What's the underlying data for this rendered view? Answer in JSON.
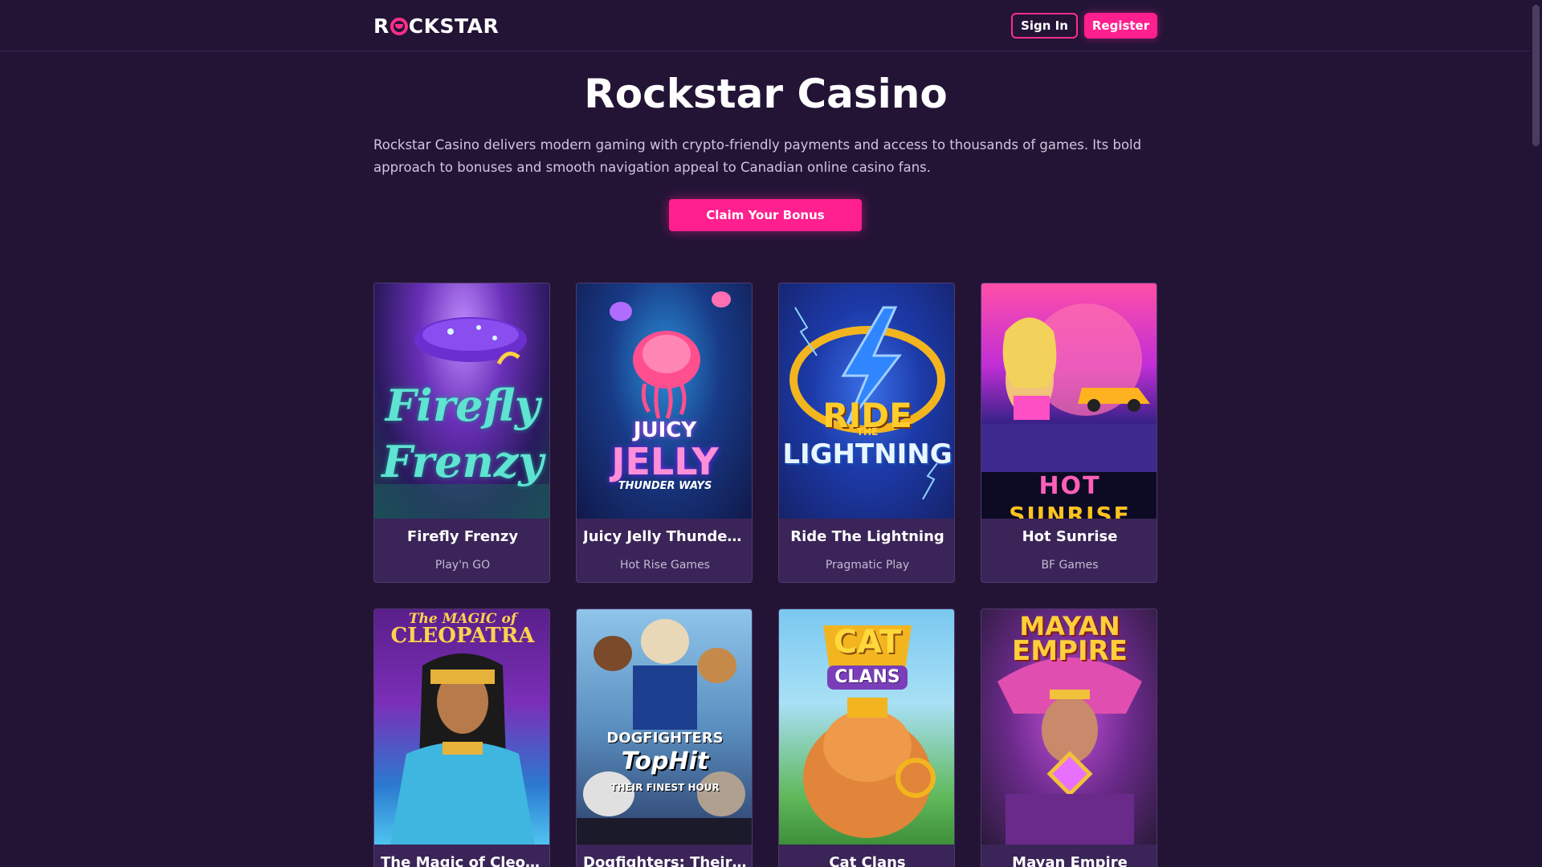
{
  "header": {
    "logo": {
      "left": "R",
      "right": "CKSTAR"
    },
    "sign_in_label": "Sign In",
    "register_label": "Register"
  },
  "hero": {
    "title": "Rockstar Casino",
    "description": "Rockstar Casino delivers modern gaming with crypto-friendly payments and access to thousands of games. Its bold approach to bonuses and smooth navigation appeal to Canadian online casino fans.",
    "cta_label": "Claim Your Bonus"
  },
  "games": [
    {
      "name": "Firefly Frenzy",
      "provider": "Play'n GO",
      "art_text": [
        "Firefly",
        "Frenzy"
      ]
    },
    {
      "name": "Juicy Jelly Thunder Ways",
      "provider": "Hot Rise Games",
      "art_text": [
        "JUICY",
        "JELLY",
        "THUNDER WAYS"
      ]
    },
    {
      "name": "Ride The Lightning",
      "provider": "Pragmatic Play",
      "art_text": [
        "RIDE",
        "THE",
        "LIGHTNING"
      ]
    },
    {
      "name": "Hot Sunrise",
      "provider": "BF Games",
      "art_text": [
        "HOT",
        "SUNRISE"
      ]
    },
    {
      "name": "The Magic of Cleopatra",
      "provider": "",
      "art_text": [
        "The MAGIC of",
        "CLEOPATRA"
      ]
    },
    {
      "name": "Dogfighters: Their Finest Hour",
      "provider": "",
      "art_text": [
        "DOGFIGHTERS",
        "TopHit",
        "THEIR FINEST HOUR"
      ]
    },
    {
      "name": "Cat Clans",
      "provider": "",
      "art_text": [
        "CAT",
        "CLANS"
      ]
    },
    {
      "name": "Mayan Empire",
      "provider": "",
      "art_text": [
        "MAYAN",
        "EMPIRE"
      ]
    }
  ],
  "colors": {
    "background": "#231436",
    "accent": "#ff1f8e",
    "card": "#3a2458"
  }
}
